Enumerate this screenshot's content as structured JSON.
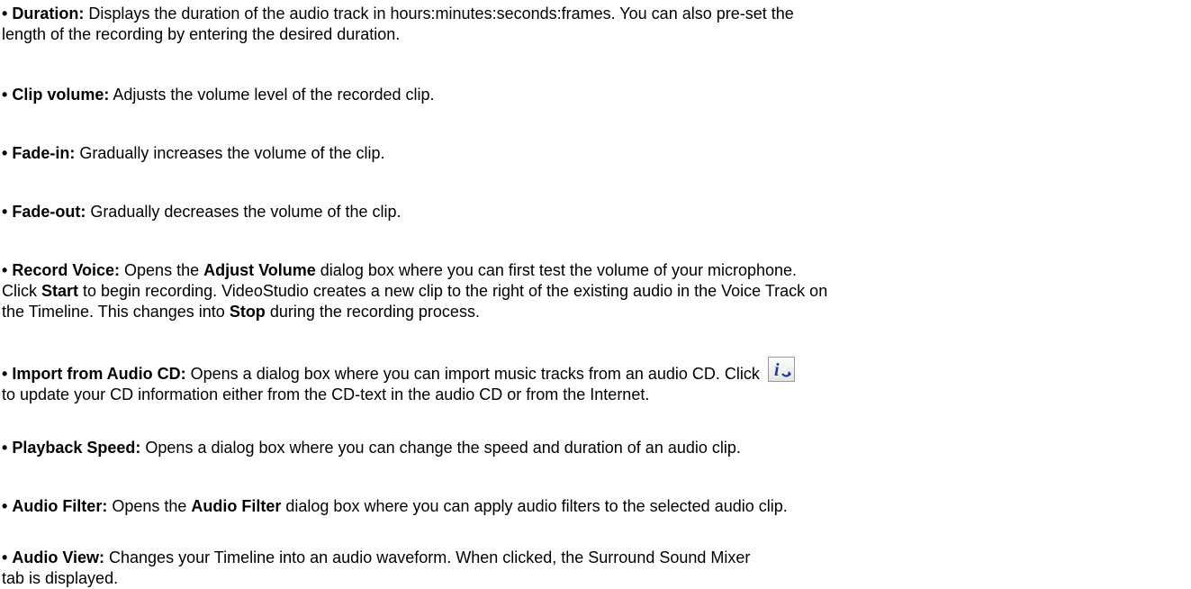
{
  "items": [
    {
      "term": "Duration:",
      "l1": " Displays the duration of the audio track in hours:minutes:seconds:frames. You can also pre-set the",
      "l2": "length of the recording by entering the desired duration."
    },
    {
      "term": "Clip volume:",
      "text": " Adjusts the volume level of the recorded clip."
    },
    {
      "term": "Fade-in:",
      "text": " Gradually increases the volume of the clip."
    },
    {
      "term": "Fade-out:",
      "text": " Gradually decreases the volume of the clip."
    },
    {
      "term": "Record Voice:",
      "s1": " Opens the ",
      "b1": "Adjust Volume",
      "s2": " dialog box where you can first test the volume of your microphone.",
      "s3": "Click ",
      "b2": "Start",
      "s4": " to begin recording. VideoStudio creates a new clip to the right of the existing audio in the Voice Track on",
      "s5": "the Timeline. This changes into ",
      "b3": "Stop",
      "s6": " during the recording process."
    },
    {
      "term": "Import from Audio CD:",
      "l1": " Opens a dialog box where you can import music tracks from an audio CD. Click ",
      "l2": "to update your CD information either from the CD-text in the audio CD or from the Internet.",
      "icon": "info-update-icon"
    },
    {
      "term": "Playback Speed:",
      "text": " Opens a dialog box where you can change the speed and duration of an audio clip."
    },
    {
      "term": "Audio Filter:",
      "s1": " Opens the ",
      "b1": "Audio Filter",
      "s2": " dialog box where you can apply audio filters to the selected audio clip."
    },
    {
      "term": "Audio View:",
      "l1": " Changes your Timeline into an audio waveform. When clicked, the Surround Sound Mixer",
      "l2": "tab is displayed."
    }
  ],
  "bullet": "•",
  "colors": {
    "text": "#000000",
    "background": "#ffffff",
    "icon_blue": "#1f3a8a"
  }
}
